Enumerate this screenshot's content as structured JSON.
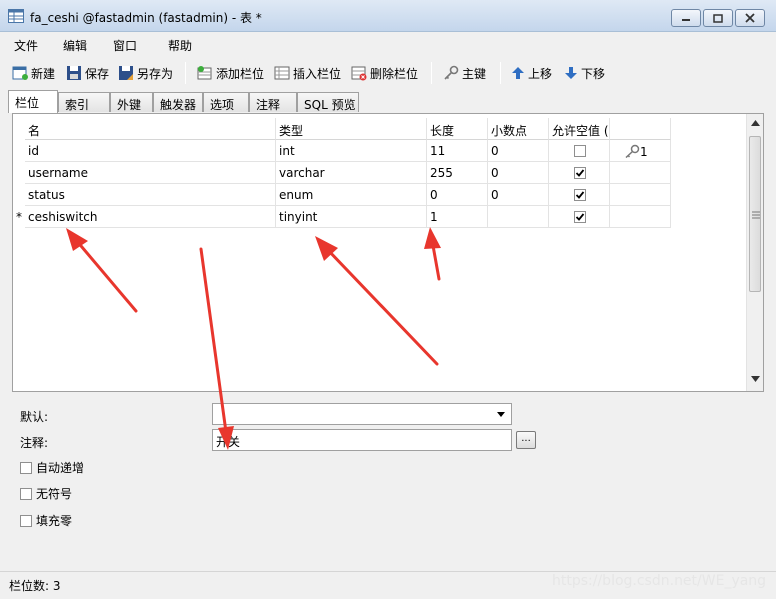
{
  "window": {
    "title": "fa_ceshi @fastadmin (fastadmin) - 表 *"
  },
  "menu": [
    "文件",
    "编辑",
    "窗口",
    "帮助"
  ],
  "toolbar": {
    "new": "新建",
    "save": "保存",
    "save_as": "另存为",
    "add_field": "添加栏位",
    "insert_field": "插入栏位",
    "delete_field": "删除栏位",
    "primary_key": "主键",
    "move_up": "上移",
    "move_down": "下移"
  },
  "tabs": [
    "栏位",
    "索引",
    "外键",
    "触发器",
    "选项",
    "注释",
    "SQL 预览"
  ],
  "grid": {
    "headers": [
      "名",
      "类型",
      "长度",
      "小数点",
      "允许空值 ("
    ],
    "rows": [
      {
        "name": "id",
        "type": "int",
        "length": "11",
        "decimals": "0",
        "nullable": false,
        "key": "1",
        "marker": ""
      },
      {
        "name": "username",
        "type": "varchar",
        "length": "255",
        "decimals": "0",
        "nullable": true,
        "key": "",
        "marker": ""
      },
      {
        "name": "status",
        "type": "enum",
        "length": "0",
        "decimals": "0",
        "nullable": true,
        "key": "",
        "marker": ""
      },
      {
        "name": "ceshiswitch",
        "type": "tinyint",
        "length": "1",
        "decimals": "",
        "nullable": true,
        "key": "",
        "marker": "*"
      }
    ]
  },
  "properties": {
    "default_label": "默认:",
    "default_value": "",
    "comment_label": "注释:",
    "comment_value": "开关",
    "browse_label": "...",
    "auto_increment_label": "自动递增",
    "unsigned_label": "无符号",
    "zerofill_label": "填充零"
  },
  "status": {
    "field_count": "栏位数: 3"
  },
  "watermark": "https://blog.csdn.net/WE_yang",
  "colors": {
    "annotation_arrow": "#e8362d",
    "titlebar": "#c4d6ec"
  }
}
